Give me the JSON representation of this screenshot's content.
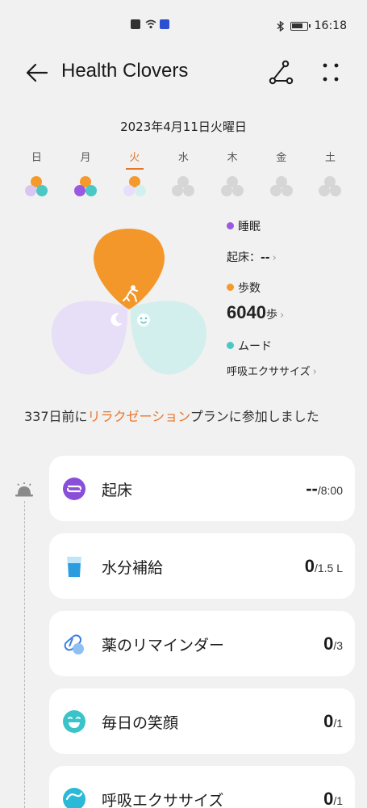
{
  "status": {
    "time": "16:18"
  },
  "header": {
    "title": "Health Clovers"
  },
  "date": "2023年4月11日火曜日",
  "week": [
    {
      "label": "日",
      "active": false,
      "colors": [
        "#f49a2c",
        "#d8c6f0",
        "#4bc7c4"
      ]
    },
    {
      "label": "月",
      "active": false,
      "colors": [
        "#f49a2c",
        "#9a5ae0",
        "#4bc7c4"
      ]
    },
    {
      "label": "火",
      "active": true,
      "colors": [
        "#f49a2c",
        "#e8defb",
        "#d2f0ef"
      ]
    },
    {
      "label": "水",
      "active": false,
      "colors": [
        "#d6d6d6",
        "#d6d6d6",
        "#d6d6d6"
      ]
    },
    {
      "label": "木",
      "active": false,
      "colors": [
        "#d6d6d6",
        "#d6d6d6",
        "#d6d6d6"
      ]
    },
    {
      "label": "金",
      "active": false,
      "colors": [
        "#d6d6d6",
        "#d6d6d6",
        "#d6d6d6"
      ]
    },
    {
      "label": "土",
      "active": false,
      "colors": [
        "#d6d6d6",
        "#d6d6d6",
        "#d6d6d6"
      ]
    }
  ],
  "legend": {
    "sleep_label": "睡眠",
    "wake_label": "起床：",
    "wake_value": "--",
    "steps_label": "歩数",
    "steps_value": "6040",
    "steps_unit": "歩",
    "mood_label": "ムード",
    "mood_value": "呼吸エクササイズ"
  },
  "plan": {
    "prefix": "337日前に",
    "highlight": "リラクゼーション",
    "suffix": "プランに参加しました"
  },
  "cards": [
    {
      "label": "起床",
      "value_big": "--",
      "value_small": "/8:00"
    },
    {
      "label": "水分補給",
      "value_big": "0",
      "value_small": "/1.5 L"
    },
    {
      "label": "薬のリマインダー",
      "value_big": "0",
      "value_small": "/3"
    },
    {
      "label": "毎日の笑顔",
      "value_big": "0",
      "value_small": "/1"
    },
    {
      "label": "呼吸エクササイズ",
      "value_big": "0",
      "value_small": "/1"
    }
  ],
  "colors": {
    "accent": "#e8742a",
    "sleep": "#9a5ae0",
    "steps": "#f49a2c",
    "mood": "#4bc7c4"
  }
}
